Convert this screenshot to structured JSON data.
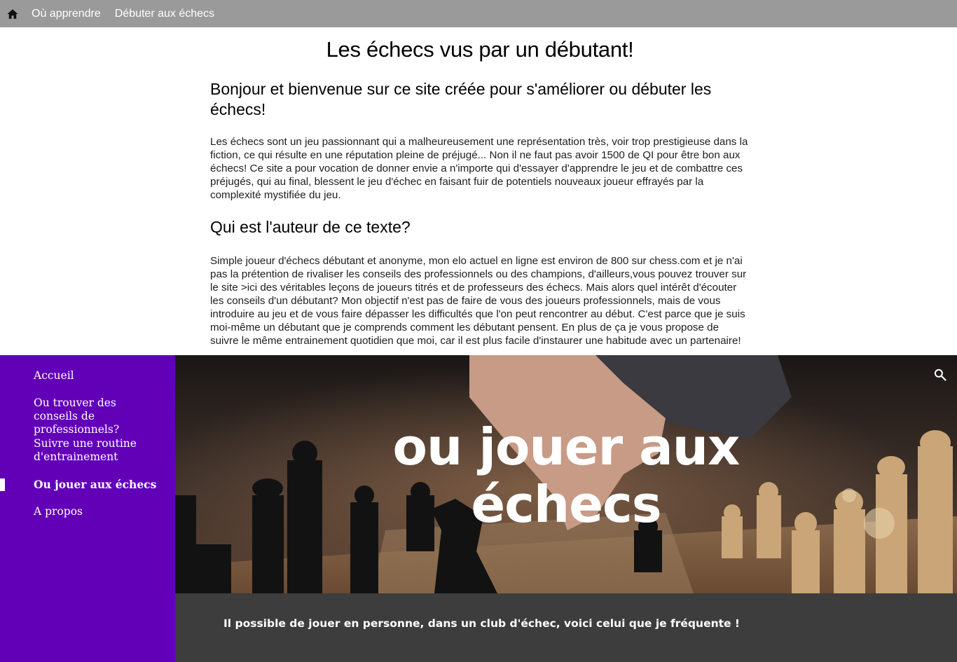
{
  "topnav": {
    "home_icon": "home-icon",
    "links": [
      "Où apprendre",
      "Débuter aux échecs"
    ]
  },
  "article": {
    "title": "Les échecs vus par un débutant!",
    "welcome_heading": "Bonjour et bienvenue sur ce site créée pour s'améliorer ou débuter les échecs!",
    "intro": "Les échecs sont un jeu passionnant qui a malheureusement une représentation très, voir trop prestigieuse dans la fiction, ce qui résulte en une réputation pleine de préjugé... Non il ne faut pas avoir 1500 de QI pour être bon aux échecs! Ce site a pour vocation de donner envie a n'importe qui d'essayer d'apprendre le jeu et de combattre ces préjugés, qui au final, blessent le jeu d'échec en faisant fuir de potentiels nouveaux joueur effrayés par la complexité mystifiée du jeu.",
    "author_heading": "Qui est l'auteur de ce texte?",
    "author_text": "Simple joueur d'échecs débutant et anonyme, mon elo actuel en ligne est environ de 800 sur chess.com et je n'ai pas la prétention de rivaliser les conseils des professionnels ou des champions, d'ailleurs,vous pouvez trouver sur le site >ici des véritables leçons de joueurs titrés et de professeurs des échecs. Mais alors quel intérêt d'écouter les conseils d'un débutant? Mon objectif n'est pas de faire de vous des joueurs professionnels, mais de vous introduire au jeu et de vous faire dépasser les difficultés que l'on peut rencontrer au début. C'est parce que je suis moi-même un débutant que je comprends comment les débutant pensent. En plus de ça je vous propose de suivre le même entrainement quotidien que moi, car il est plus facile d'instaurer une habitude avec un partenaire!"
  },
  "sidebar": {
    "items": [
      {
        "label": "Accueil",
        "active": false
      },
      {
        "label": "Ou trouver des conseils de professionnels?",
        "active": false
      },
      {
        "label": "Suivre une routine d'entrainement",
        "active": false
      },
      {
        "label": "Ou jouer aux échecs",
        "active": true
      },
      {
        "label": "A propos",
        "active": false
      }
    ]
  },
  "hero": {
    "title_line1": "ou jouer aux",
    "title_line2": "échecs",
    "search_icon": "search-icon",
    "background": "chessboard-photo"
  },
  "footer_band": {
    "text": "Il possible de jouer en personne, dans un club d'échec, voici celui que je fréquente !"
  },
  "colors": {
    "topnav": "#9a9a9a",
    "sidebar": "#6200b8",
    "footer_band": "#3d3d3d"
  }
}
